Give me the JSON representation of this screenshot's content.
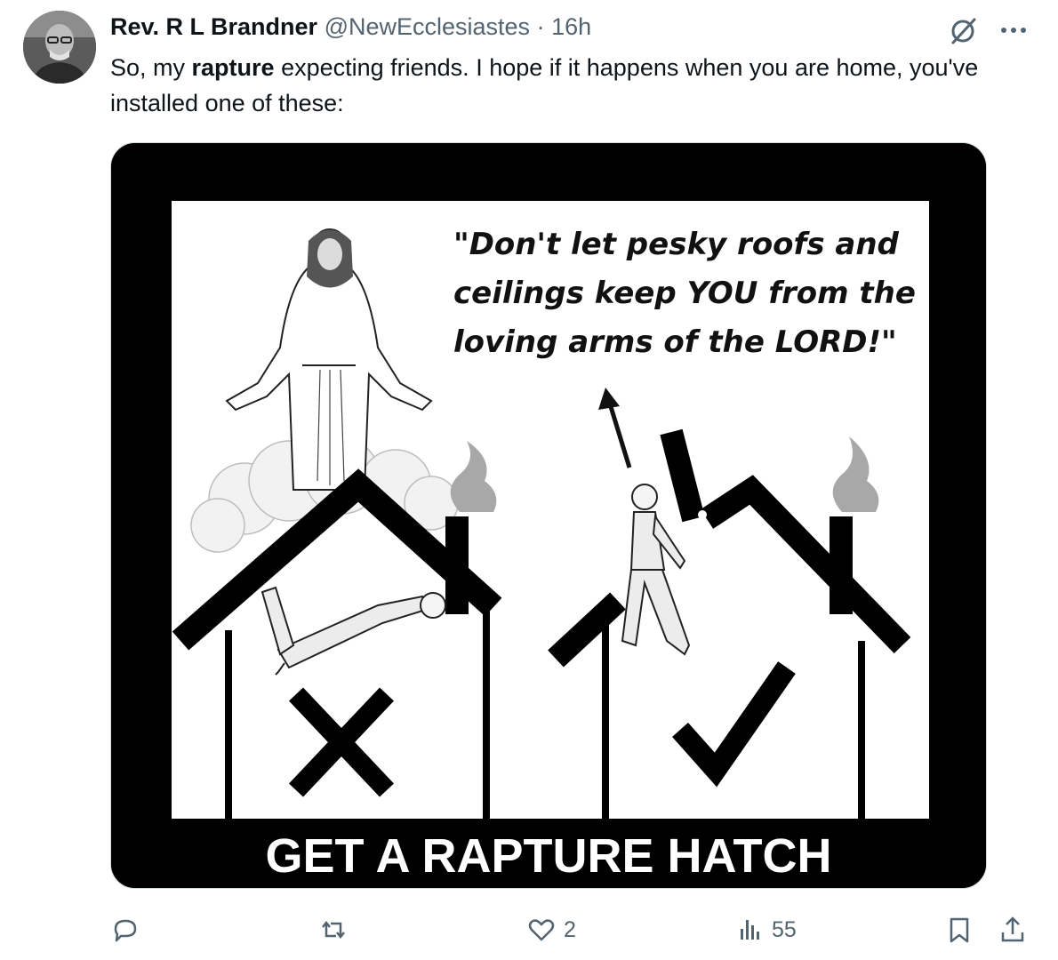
{
  "tweet": {
    "author": {
      "display_name": "Rev. R L Brandner",
      "handle": "@NewEcclesiastes",
      "separator": "·",
      "time": "16h"
    },
    "text_before": "So, my ",
    "text_bold": "rapture",
    "text_after": " expecting friends. I hope if it happens when you are home, you've installed one of these:",
    "image": {
      "quote_line1": "\"Don't let pesky roofs and",
      "quote_line2": "ceilings keep YOU from the",
      "quote_line3": "loving arms of the LORD!\"",
      "banner": "GET A RAPTURE HATCH"
    },
    "metrics": {
      "replies": "",
      "reposts": "",
      "likes": "2",
      "views": "55"
    }
  },
  "icons": {
    "reply": "reply-icon",
    "repost": "repost-icon",
    "like": "heart-icon",
    "views": "views-icon",
    "bookmark": "bookmark-icon",
    "share": "share-icon",
    "grok": "grok-icon",
    "more": "more-icon"
  },
  "colors": {
    "text": "#0f1419",
    "secondary": "#536471",
    "border": "#cfd9de"
  }
}
